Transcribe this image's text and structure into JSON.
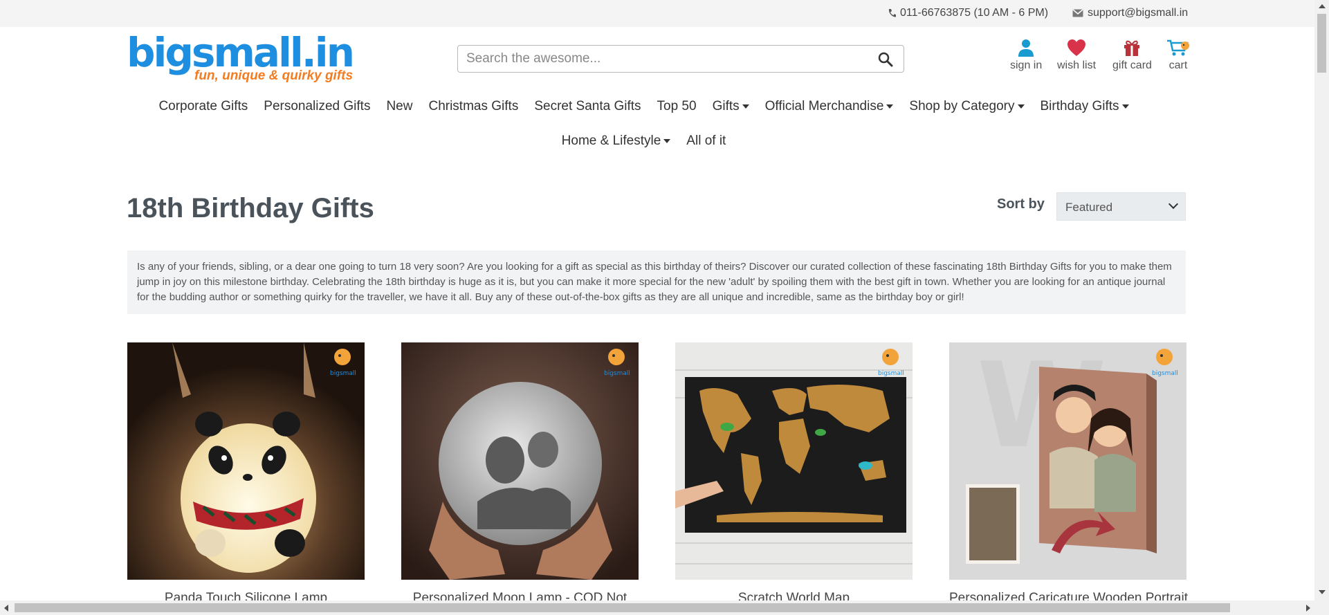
{
  "topbar": {
    "phone": "011-66763875 (10 AM - 6 PM)",
    "email": "support@bigsmall.in"
  },
  "brand": {
    "name": "bigsmall.in",
    "tagline": "fun, unique & quirky gifts"
  },
  "search": {
    "placeholder": "Search the awesome..."
  },
  "header_actions": {
    "sign_in": "sign in",
    "wish_list": "wish list",
    "gift_card": "gift card",
    "cart": "cart"
  },
  "nav": {
    "row1": [
      "Corporate Gifts",
      "Personalized Gifts",
      "New",
      "Christmas Gifts",
      "Secret Santa Gifts",
      "Top 50",
      "Gifts",
      "Official Merchandise",
      "Shop by Category",
      "Birthday Gifts"
    ],
    "row2": [
      "Home & Lifestyle",
      "All of it"
    ]
  },
  "page": {
    "title": "18th Birthday Gifts",
    "sort_label": "Sort by",
    "sort_value": "Featured",
    "description": "Is any of your friends, sibling, or a dear one going to turn 18 very soon? Are you looking for a gift as special as this birthday of theirs? Discover our curated collection of these fascinating 18th Birthday Gifts for you to make them jump in joy on this milestone birthday. Celebrating the 18th birthday is huge as it is, but you can make it more special for the new 'adult' by spoiling them with the best gift in town. Whether you are looking for an antique journal for the budding author or something quirky for the traveller, we have it all. Buy any of these out-of-the-box gifts as they are all unique and incredible, same as the birthday boy or girl!"
  },
  "products": [
    {
      "name": "Panda Touch Silicone Lamp"
    },
    {
      "name": "Personalized Moon Lamp - COD Not"
    },
    {
      "name": "Scratch World Map"
    },
    {
      "name": "Personalized Caricature Wooden Portrait"
    }
  ],
  "colors": {
    "brand_blue": "#1e8ee0",
    "brand_orange": "#f27c21",
    "icon_teal": "#1a9bd0",
    "heart_red": "#d9334a"
  }
}
